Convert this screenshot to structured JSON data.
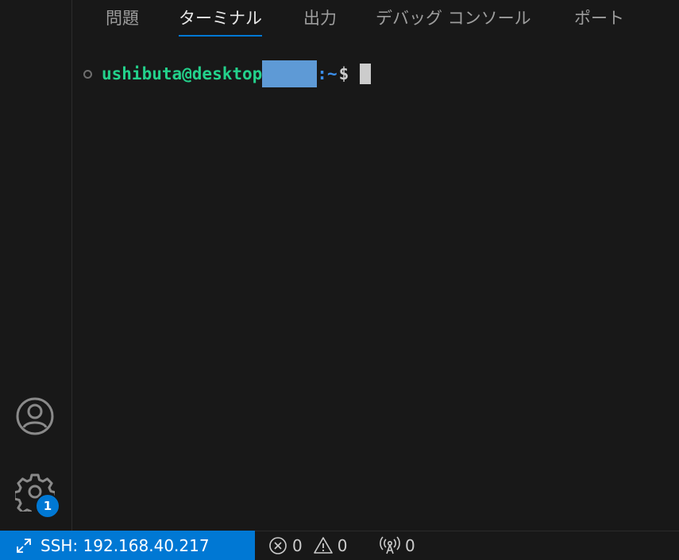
{
  "panel": {
    "tabs": [
      {
        "label": "問題"
      },
      {
        "label": "ターミナル",
        "active": true
      },
      {
        "label": "出力"
      },
      {
        "label": "デバッグ コンソール"
      },
      {
        "label": "ポート"
      }
    ]
  },
  "terminal": {
    "user_host": "ushibuta@desktop",
    "path_sep": ":~",
    "prompt_symbol": "$"
  },
  "activity_bar": {
    "settings_badge": "1"
  },
  "status_bar": {
    "remote_label": "SSH: 192.168.40.217",
    "errors": "0",
    "warnings": "0",
    "ports": "0"
  },
  "colors": {
    "accent": "#0078d4",
    "user_host": "#23d18b",
    "path": "#3b8eea",
    "background": "#181818"
  }
}
